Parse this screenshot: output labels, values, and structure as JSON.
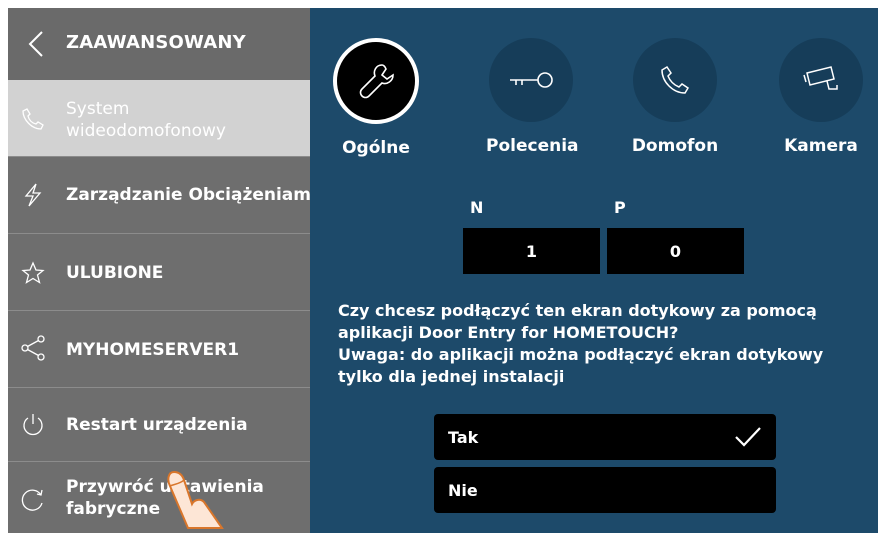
{
  "sidebar": {
    "title": "ZAAWANSOWANY",
    "items": [
      {
        "label_line1": "System",
        "label_line2": "wideodomofonowy",
        "icon": "phone-icon",
        "active": true
      },
      {
        "label": "Zarządzanie Obciążeniami",
        "icon": "lightning-icon"
      },
      {
        "label": "ULUBIONE",
        "icon": "star-icon"
      },
      {
        "label": "MYHOMESERVER1",
        "icon": "share-icon"
      },
      {
        "label": "Restart urządzenia",
        "icon": "power-icon"
      },
      {
        "label_line1": "Przywróć ustawienia",
        "label_line2": "fabryczne",
        "icon": "reset-icon"
      }
    ]
  },
  "tabs": [
    {
      "label": "Ogólne",
      "icon": "wrench-icon",
      "active": true
    },
    {
      "label": "Polecenia",
      "icon": "key-icon"
    },
    {
      "label": "Domofon",
      "icon": "handset-icon"
    },
    {
      "label": "Kamera",
      "icon": "camera-icon"
    }
  ],
  "code": {
    "n_label": "N",
    "n_value": "1",
    "p_label": "P",
    "p_value": "0"
  },
  "question": {
    "line1": "Czy chcesz podłączyć ten ekran dotykowy za pomocą",
    "line2": "aplikacji Door Entry for HOMETOUCH?",
    "line3": "Uwaga: do aplikacji można podłączyć ekran dotykowy",
    "line4": "tylko dla jednej instalacji"
  },
  "options": [
    {
      "label": "Tak",
      "selected": true
    },
    {
      "label": "Nie",
      "selected": false
    }
  ],
  "colors": {
    "main_bg": "#1d4a6a",
    "sidebar_bg": "#6e6e6e",
    "active_item_bg": "#d2d2d2"
  }
}
